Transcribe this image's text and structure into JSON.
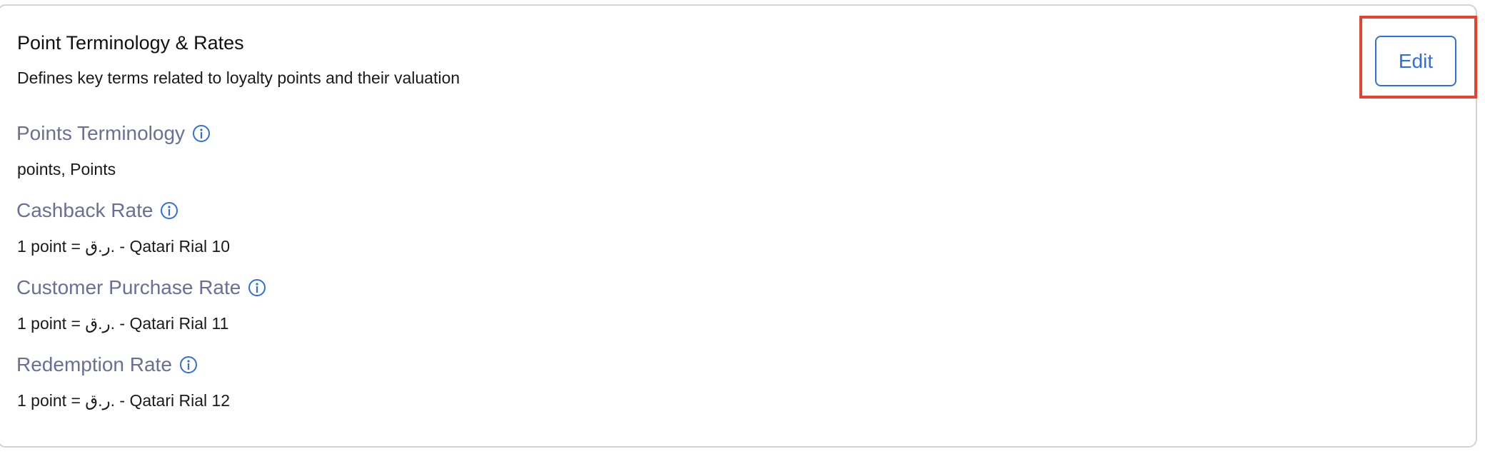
{
  "section": {
    "title": "Point Terminology & Rates",
    "subtitle": "Defines key terms related to loyalty points and their valuation",
    "edit_label": "Edit"
  },
  "fields": [
    {
      "label": "Points Terminology",
      "value": "points, Points",
      "icon": "info-icon"
    },
    {
      "label": "Cashback Rate",
      "value": "1 point = ر.ق. - Qatari Rial 10",
      "icon": "info-icon"
    },
    {
      "label": "Customer Purchase Rate",
      "value": "1 point = ر.ق. - Qatari Rial 11",
      "icon": "info-icon"
    },
    {
      "label": "Redemption Rate",
      "value": "1 point = ر.ق. - Qatari Rial 12",
      "icon": "info-icon"
    }
  ],
  "colors": {
    "accent": "#2f6fe0",
    "label": "#6a6f95",
    "highlight": "#e3432f"
  }
}
